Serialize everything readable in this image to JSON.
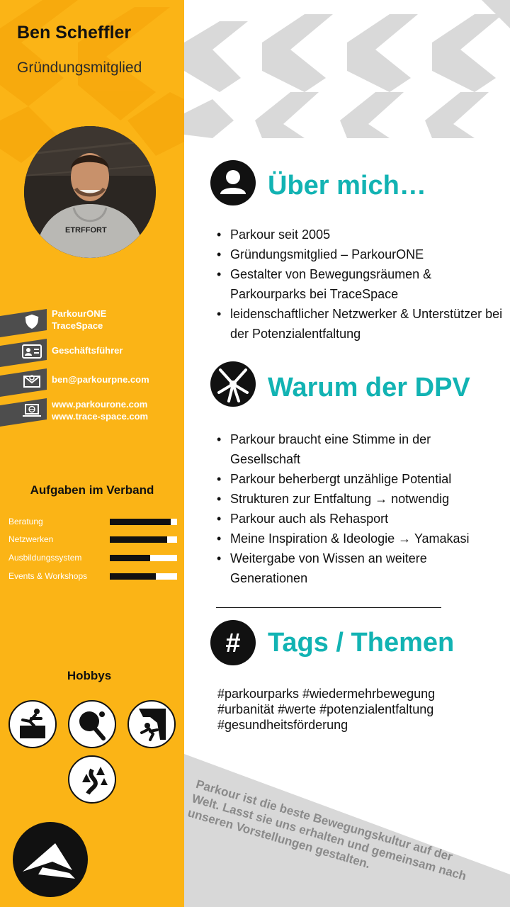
{
  "profile": {
    "name": "Ben Scheffler",
    "role": "Gründungsmitglied",
    "photo_icon": "profile-photo"
  },
  "contacts": [
    {
      "icon": "shield-icon",
      "lines": [
        "ParkourONE",
        "TraceSpace"
      ]
    },
    {
      "icon": "id-card-icon",
      "lines": [
        "Geschäftsführer"
      ]
    },
    {
      "icon": "envelope-icon",
      "lines": [
        "ben@parkourpne.com"
      ]
    },
    {
      "icon": "laptop-globe-icon",
      "lines": [
        "www.parkourone.com",
        "www.trace-space.com"
      ]
    }
  ],
  "tasks": {
    "title": "Aufgaben im Verband",
    "items": [
      {
        "label": "Beratung",
        "level": 0.91
      },
      {
        "label": "Netzwerken",
        "level": 0.85
      },
      {
        "label": "Ausbildungssystem",
        "level": 0.6
      },
      {
        "label": "Events & Workshops",
        "level": 0.68
      }
    ]
  },
  "hobbies": {
    "title": "Hobbys",
    "items": [
      "parkour-vault-icon",
      "table-tennis-icon",
      "climbing-icon",
      "trail-running-icon"
    ]
  },
  "logo": "parkourone-logo",
  "sections": {
    "about": {
      "title": "Über mich…",
      "icon": "user-icon",
      "items": [
        "Parkour seit 2005",
        "Gründungsmitglied – ParkourONE",
        "Gestalter von Bewegungsräumen & Parkourparks bei TraceSpace",
        "leidenschaftlicher Netzwerker & Unterstützer bei der Potenzialentfaltung"
      ]
    },
    "why": {
      "title": "Warum der DPV",
      "icon": "hands-together-icon",
      "items": [
        "Parkour braucht eine Stimme in der Gesellschaft",
        "Parkour beherbergt unzählige Potential",
        "Strukturen zur Entfaltung → notwendig",
        "Parkour auch als Rehasport",
        "Meine Inspiration & Ideologie → Yamakasi",
        "Weitergabe von Wissen an weitere Generationen"
      ]
    },
    "tags": {
      "title": "Tags / Themen",
      "icon": "hashtag-icon",
      "items": [
        "#parkourparks",
        "#wiedermehrbewegung",
        "#urbanität",
        "#werte",
        "#potenzialentfaltung",
        "#gesundheitsförderung"
      ]
    }
  },
  "quote": "Parkour ist die beste Bewegungskultur auf der Welt. Lasst sie uns erhalten und gemeinsam nach unseren Vorstellungen gestalten.",
  "colors": {
    "accent_yellow": "#fbb416",
    "accent_teal": "#12b3b3",
    "dark": "#111111",
    "contact_band": "#4d4d4d",
    "pattern_grey": "#d8d8d8"
  }
}
